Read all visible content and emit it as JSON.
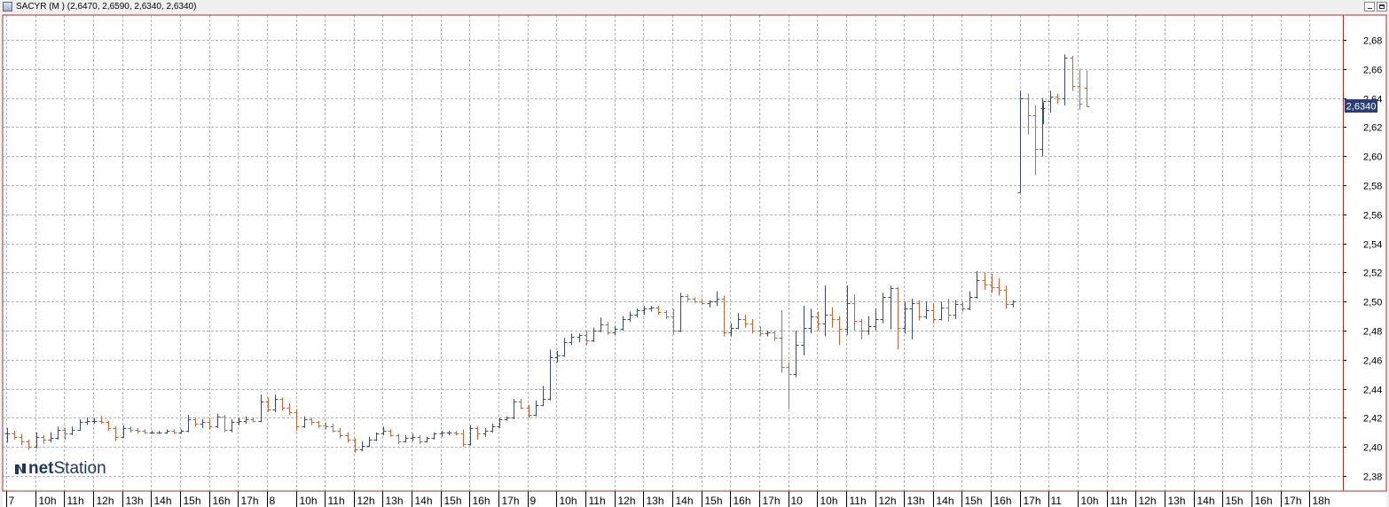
{
  "window": {
    "title": "SACYR (M ) (2,6470, 2,6590, 2,6340, 2,6340)"
  },
  "watermark": {
    "brand_bold": "net",
    "brand_light": "Station"
  },
  "colors": {
    "up": "#3b4a6b",
    "down": "#c1693a",
    "grid": "#b4b4b4",
    "frame": "#a33333",
    "last_price_bg": "#2a3d78",
    "last_price_text": "#ffffff"
  },
  "chart_data": {
    "type": "ohlc",
    "ylim": [
      2.37,
      2.69
    ],
    "yticks": [
      "2,68",
      "2,66",
      "2,64",
      "2,62",
      "2,60",
      "2,58",
      "2,56",
      "2,54",
      "2,52",
      "2,50",
      "2,48",
      "2,46",
      "2,44",
      "2,42",
      "2,40",
      "2,38"
    ],
    "ytick_values": [
      2.68,
      2.66,
      2.64,
      2.62,
      2.6,
      2.58,
      2.56,
      2.54,
      2.52,
      2.5,
      2.48,
      2.46,
      2.44,
      2.42,
      2.4,
      2.38
    ],
    "x_axis_labels": [
      "7",
      "10h",
      "11h",
      "12h",
      "13h",
      "14h",
      "15h",
      "16h",
      "17h",
      "8",
      "10h",
      "11h",
      "12h",
      "13h",
      "14h",
      "15h",
      "16h",
      "17h",
      "9",
      "10h",
      "11h",
      "12h",
      "13h",
      "14h",
      "15h",
      "16h",
      "17h",
      "10",
      "10h",
      "11h",
      "12h",
      "13h",
      "14h",
      "15h",
      "16h",
      "17h",
      "11",
      "10h",
      "11h",
      "12h",
      "13h",
      "14h",
      "15h",
      "16h",
      "17h",
      "18h"
    ],
    "last_price": "2,6340",
    "bars": [
      [
        2.409,
        2.413,
        2.403,
        2.409
      ],
      [
        2.409,
        2.411,
        2.405,
        2.407
      ],
      [
        2.407,
        2.409,
        2.401,
        2.404
      ],
      [
        2.404,
        2.405,
        2.398,
        2.4
      ],
      [
        2.4,
        2.41,
        2.399,
        2.407
      ],
      [
        2.407,
        2.408,
        2.402,
        2.405
      ],
      [
        2.405,
        2.41,
        2.403,
        2.406
      ],
      [
        2.406,
        2.414,
        2.405,
        2.412
      ],
      [
        2.412,
        2.413,
        2.405,
        2.409
      ],
      [
        2.409,
        2.414,
        2.408,
        2.412
      ],
      [
        2.412,
        2.419,
        2.411,
        2.417
      ],
      [
        2.417,
        2.42,
        2.415,
        2.418
      ],
      [
        2.418,
        2.42,
        2.416,
        2.418
      ],
      [
        2.418,
        2.421,
        2.416,
        2.417
      ],
      [
        2.417,
        2.418,
        2.411,
        2.413
      ],
      [
        2.413,
        2.414,
        2.404,
        2.407
      ],
      [
        2.407,
        2.415,
        2.406,
        2.413
      ],
      [
        2.413,
        2.414,
        2.41,
        2.412
      ],
      [
        2.412,
        2.413,
        2.409,
        2.411
      ],
      [
        2.411,
        2.412,
        2.409,
        2.41
      ],
      [
        2.41,
        2.411,
        2.409,
        2.41
      ],
      [
        2.41,
        2.411,
        2.409,
        2.41
      ],
      [
        2.41,
        2.412,
        2.409,
        2.411
      ],
      [
        2.411,
        2.412,
        2.409,
        2.41
      ],
      [
        2.41,
        2.412,
        2.409,
        2.411
      ],
      [
        2.411,
        2.422,
        2.41,
        2.419
      ],
      [
        2.419,
        2.42,
        2.414,
        2.416
      ],
      [
        2.416,
        2.419,
        2.413,
        2.417
      ],
      [
        2.417,
        2.42,
        2.412,
        2.414
      ],
      [
        2.414,
        2.423,
        2.413,
        2.421
      ],
      [
        2.421,
        2.422,
        2.41,
        2.412
      ],
      [
        2.412,
        2.419,
        2.41,
        2.417
      ],
      [
        2.417,
        2.42,
        2.415,
        2.418
      ],
      [
        2.418,
        2.421,
        2.416,
        2.419
      ],
      [
        2.419,
        2.42,
        2.417,
        2.418
      ],
      [
        2.418,
        2.436,
        2.417,
        2.431
      ],
      [
        2.431,
        2.434,
        2.424,
        2.426
      ],
      [
        2.426,
        2.436,
        2.424,
        2.433
      ],
      [
        2.433,
        2.434,
        2.425,
        2.427
      ],
      [
        2.427,
        2.43,
        2.422,
        2.424
      ],
      [
        2.424,
        2.426,
        2.411,
        2.414
      ],
      [
        2.414,
        2.421,
        2.413,
        2.419
      ],
      [
        2.419,
        2.42,
        2.415,
        2.417
      ],
      [
        2.417,
        2.418,
        2.413,
        2.415
      ],
      [
        2.415,
        2.417,
        2.412,
        2.414
      ],
      [
        2.414,
        2.416,
        2.41,
        2.411
      ],
      [
        2.411,
        2.413,
        2.406,
        2.408
      ],
      [
        2.408,
        2.41,
        2.403,
        2.405
      ],
      [
        2.405,
        2.406,
        2.396,
        2.398
      ],
      [
        2.398,
        2.404,
        2.397,
        2.401
      ],
      [
        2.401,
        2.407,
        2.4,
        2.405
      ],
      [
        2.405,
        2.41,
        2.404,
        2.409
      ],
      [
        2.409,
        2.414,
        2.408,
        2.411
      ],
      [
        2.411,
        2.412,
        2.407,
        2.408
      ],
      [
        2.408,
        2.409,
        2.402,
        2.404
      ],
      [
        2.404,
        2.408,
        2.403,
        2.406
      ],
      [
        2.406,
        2.409,
        2.404,
        2.407
      ],
      [
        2.407,
        2.408,
        2.402,
        2.404
      ],
      [
        2.404,
        2.407,
        2.403,
        2.406
      ],
      [
        2.406,
        2.41,
        2.405,
        2.409
      ],
      [
        2.409,
        2.411,
        2.407,
        2.41
      ],
      [
        2.41,
        2.411,
        2.408,
        2.41
      ],
      [
        2.41,
        2.411,
        2.408,
        2.409
      ],
      [
        2.409,
        2.412,
        2.4,
        2.402
      ],
      [
        2.402,
        2.415,
        2.401,
        2.413
      ],
      [
        2.413,
        2.414,
        2.405,
        2.409
      ],
      [
        2.409,
        2.413,
        2.407,
        2.411
      ],
      [
        2.411,
        2.416,
        2.41,
        2.414
      ],
      [
        2.414,
        2.42,
        2.413,
        2.419
      ],
      [
        2.419,
        2.421,
        2.418,
        2.42
      ],
      [
        2.42,
        2.433,
        2.419,
        2.431
      ],
      [
        2.431,
        2.433,
        2.426,
        2.427
      ],
      [
        2.427,
        2.429,
        2.42,
        2.422
      ],
      [
        2.422,
        2.432,
        2.421,
        2.429
      ],
      [
        2.429,
        2.442,
        2.428,
        2.433
      ],
      [
        2.433,
        2.467,
        2.432,
        2.462
      ],
      [
        2.462,
        2.466,
        2.458,
        2.463
      ],
      [
        2.463,
        2.475,
        2.462,
        2.472
      ],
      [
        2.472,
        2.478,
        2.47,
        2.476
      ],
      [
        2.476,
        2.478,
        2.472,
        2.477
      ],
      [
        2.477,
        2.48,
        2.47,
        2.473
      ],
      [
        2.473,
        2.482,
        2.472,
        2.48
      ],
      [
        2.48,
        2.489,
        2.479,
        2.484
      ],
      [
        2.484,
        2.486,
        2.477,
        2.479
      ],
      [
        2.479,
        2.483,
        2.477,
        2.481
      ],
      [
        2.481,
        2.49,
        2.48,
        2.488
      ],
      [
        2.488,
        2.493,
        2.486,
        2.491
      ],
      [
        2.491,
        2.495,
        2.489,
        2.494
      ],
      [
        2.494,
        2.497,
        2.491,
        2.495
      ],
      [
        2.495,
        2.497,
        2.493,
        2.496
      ],
      [
        2.496,
        2.497,
        2.491,
        2.493
      ],
      [
        2.493,
        2.494,
        2.488,
        2.49
      ],
      [
        2.49,
        2.495,
        2.477,
        2.48
      ],
      [
        2.48,
        2.506,
        2.479,
        2.504
      ],
      [
        2.504,
        2.505,
        2.5,
        2.502
      ],
      [
        2.502,
        2.503,
        2.499,
        2.5
      ],
      [
        2.5,
        2.502,
        2.498,
        2.499
      ],
      [
        2.499,
        2.501,
        2.496,
        2.5
      ],
      [
        2.5,
        2.507,
        2.497,
        2.502
      ],
      [
        2.502,
        2.504,
        2.476,
        2.479
      ],
      [
        2.479,
        2.485,
        2.476,
        2.482
      ],
      [
        2.482,
        2.492,
        2.481,
        2.488
      ],
      [
        2.488,
        2.491,
        2.482,
        2.485
      ],
      [
        2.485,
        2.488,
        2.478,
        2.48
      ],
      [
        2.48,
        2.483,
        2.476,
        2.478
      ],
      [
        2.478,
        2.48,
        2.476,
        2.479
      ],
      [
        2.479,
        2.48,
        2.473,
        2.475
      ],
      [
        2.475,
        2.494,
        2.451,
        2.455
      ],
      [
        2.455,
        2.458,
        2.426,
        2.45
      ],
      [
        2.45,
        2.48,
        2.448,
        2.47
      ],
      [
        2.47,
        2.497,
        2.463,
        2.482
      ],
      [
        2.482,
        2.495,
        2.478,
        2.49
      ],
      [
        2.49,
        2.493,
        2.48,
        2.485
      ],
      [
        2.485,
        2.511,
        2.476,
        2.491
      ],
      [
        2.491,
        2.496,
        2.482,
        2.488
      ],
      [
        2.488,
        2.49,
        2.47,
        2.481
      ],
      [
        2.481,
        2.511,
        2.477,
        2.499
      ],
      [
        2.499,
        2.505,
        2.48,
        2.487
      ],
      [
        2.487,
        2.488,
        2.474,
        2.48
      ],
      [
        2.48,
        2.49,
        2.477,
        2.483
      ],
      [
        2.483,
        2.495,
        2.48,
        2.488
      ],
      [
        2.488,
        2.506,
        2.485,
        2.503
      ],
      [
        2.503,
        2.511,
        2.481,
        2.509
      ],
      [
        2.509,
        2.51,
        2.467,
        2.482
      ],
      [
        2.482,
        2.5,
        2.478,
        2.495
      ],
      [
        2.495,
        2.502,
        2.474,
        2.499
      ],
      [
        2.499,
        2.501,
        2.487,
        2.49
      ],
      [
        2.49,
        2.5,
        2.488,
        2.494
      ],
      [
        2.494,
        2.499,
        2.485,
        2.488
      ],
      [
        2.488,
        2.5,
        2.487,
        2.496
      ],
      [
        2.496,
        2.502,
        2.486,
        2.491
      ],
      [
        2.491,
        2.501,
        2.488,
        2.498
      ],
      [
        2.498,
        2.5,
        2.493,
        2.495
      ],
      [
        2.495,
        2.507,
        2.494,
        2.503
      ],
      [
        2.503,
        2.521,
        2.502,
        2.515
      ],
      [
        2.515,
        2.52,
        2.508,
        2.512
      ],
      [
        2.512,
        2.519,
        2.506,
        2.51
      ],
      [
        2.51,
        2.516,
        2.504,
        2.508
      ],
      [
        2.508,
        2.511,
        2.495,
        2.498
      ],
      [
        2.498,
        2.501,
        2.496,
        2.5
      ],
      [
        2.575,
        2.645,
        2.575,
        2.64
      ],
      [
        2.64,
        2.643,
        2.615,
        2.628
      ],
      [
        2.628,
        2.635,
        2.587,
        2.605
      ],
      [
        2.605,
        2.64,
        2.6,
        2.633
      ],
      [
        2.633,
        2.637,
        2.622,
        2.638
      ],
      [
        2.638,
        2.645,
        2.63,
        2.641
      ],
      [
        2.641,
        2.643,
        2.636,
        2.64
      ],
      [
        2.64,
        2.67,
        2.635,
        2.668
      ],
      [
        2.668,
        2.669,
        2.645,
        2.648
      ],
      [
        2.648,
        2.66,
        2.632,
        2.636
      ],
      [
        2.647,
        2.659,
        2.634,
        2.634
      ]
    ]
  }
}
